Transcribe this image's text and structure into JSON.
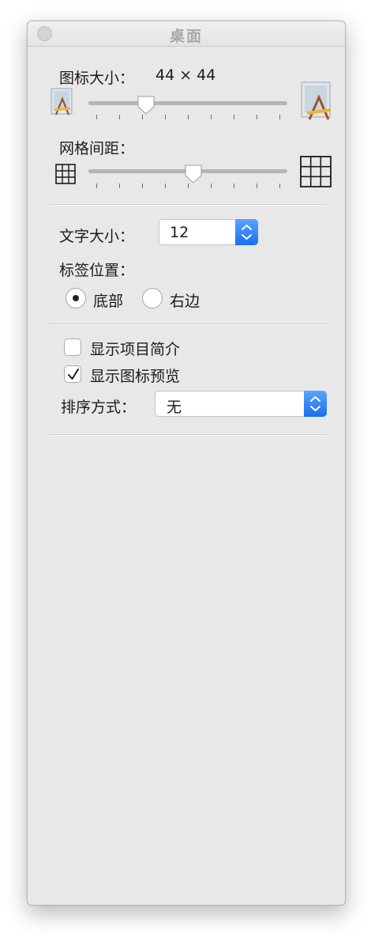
{
  "window": {
    "title": "桌面"
  },
  "icon_size": {
    "label": "图标大小：",
    "value": "44 × 44",
    "slider_fraction": 0.27
  },
  "grid_spacing": {
    "label": "网格间距：",
    "slider_fraction": 0.53
  },
  "text_size": {
    "label": "文字大小：",
    "value": "12"
  },
  "label_position": {
    "label": "标签位置：",
    "options": [
      {
        "label": "底部",
        "selected": true
      },
      {
        "label": "右边",
        "selected": false
      }
    ]
  },
  "checkboxes": [
    {
      "label": "显示项目简介",
      "checked": false
    },
    {
      "label": "显示图标预览",
      "checked": true
    }
  ],
  "sort_by": {
    "label": "排序方式：",
    "value": "无"
  },
  "colors": {
    "accent": "#1a6ff2",
    "panel": "#e8e8e8"
  }
}
